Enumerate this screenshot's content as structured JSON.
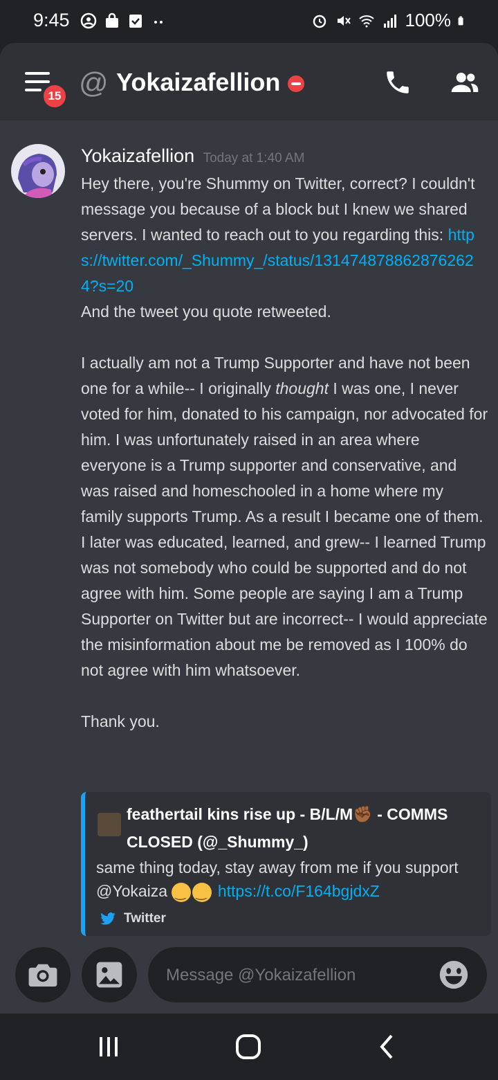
{
  "status_bar": {
    "time": "9:45",
    "battery": "100%",
    "icons": [
      "face-icon",
      "bag-icon",
      "clipboard-check-icon",
      "more-dots-icon",
      "alarm-icon",
      "mute-icon",
      "wifi-icon",
      "signal-icon",
      "battery-icon"
    ]
  },
  "header": {
    "title": "Yokaizafellion",
    "at": "@",
    "unread_badge": "15",
    "status": "do-not-disturb",
    "status_color": "#ed4245"
  },
  "message": {
    "author": "Yokaizafellion",
    "timestamp": "Today at 1:40 AM",
    "p1": "Hey there, you're Shummy on Twitter, correct? I couldn't message you because of a block but I knew we shared servers. I wanted to reach out to you regarding this:",
    "link": "https://twitter.com/_Shummy_/status/1314748788628762624?s=20",
    "p1b": "And the tweet you quote retweeted.",
    "p2a": "I actually am not a Trump Supporter and have not been one for a while-- I originally ",
    "p2_emph": "thought",
    "p2b": " I was one, I never voted for him, donated to his campaign, nor advocated for him. I was unfortunately raised in an area where everyone is a Trump supporter and conservative, and was raised and homeschooled in a home where my family supports Trump. As a result I became one of them. I later was educated, learned, and grew-- I learned Trump was not somebody who could be supported and do not agree with him. Some people are saying I am a Trump Supporter on Twitter but are incorrect-- I would appreciate the misinformation about me be removed as I 100% do not agree with him whatsoever.",
    "p3": "Thank you."
  },
  "embed": {
    "author": "feathertail kins rise up - B/L/M✊🏾 - COMMS CLOSED (@_Shummy_)",
    "text": "same thing today, stay away from me if you support @Yokaiza ",
    "link": "https://t.co/F164bgjdxZ",
    "footer": "Twitter",
    "accent": "#1da1f2"
  },
  "input": {
    "placeholder": "Message @Yokaizafellion"
  },
  "colors": {
    "background": "#36393f",
    "header": "#2f3136",
    "link": "#00b0f4"
  }
}
